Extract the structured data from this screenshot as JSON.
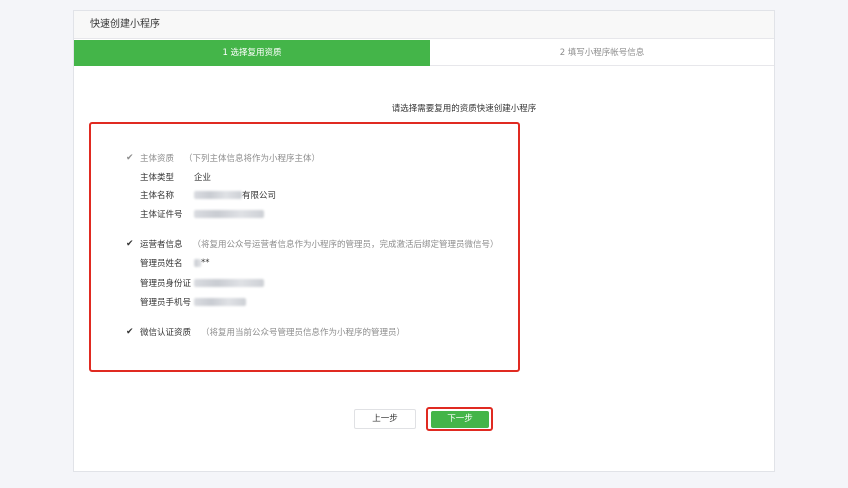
{
  "header": {
    "title": "快速创建小程序"
  },
  "steps": [
    {
      "label": "1 选择复用资质"
    },
    {
      "label": "2 填写小程序帐号信息"
    }
  ],
  "intro": "请选择需要复用的资质快速创建小程序",
  "subject": {
    "title": "主体资质",
    "hint": "（下列主体信息将作为小程序主体）",
    "rows": [
      {
        "label": "主体类型",
        "value": "企业"
      },
      {
        "label": "主体名称",
        "value": "有限公司"
      },
      {
        "label": "主体证件号",
        "value": ""
      }
    ]
  },
  "operator": {
    "title": "运营者信息",
    "hint": "（将复用公众号运营者信息作为小程序的管理员，完成激活后绑定管理员微信号）",
    "rows": [
      {
        "label": "管理员姓名",
        "value": "**"
      },
      {
        "label": "管理员身份证",
        "value": ""
      },
      {
        "label": "管理员手机号",
        "value": ""
      }
    ]
  },
  "wechat_cert": {
    "title": "微信认证资质",
    "hint": "（将复用当前公众号管理员信息作为小程序的管理员）"
  },
  "buttons": {
    "prev": "上一步",
    "next": "下一步"
  },
  "colors": {
    "accent": "#44b549",
    "highlight": "#e02a21"
  }
}
